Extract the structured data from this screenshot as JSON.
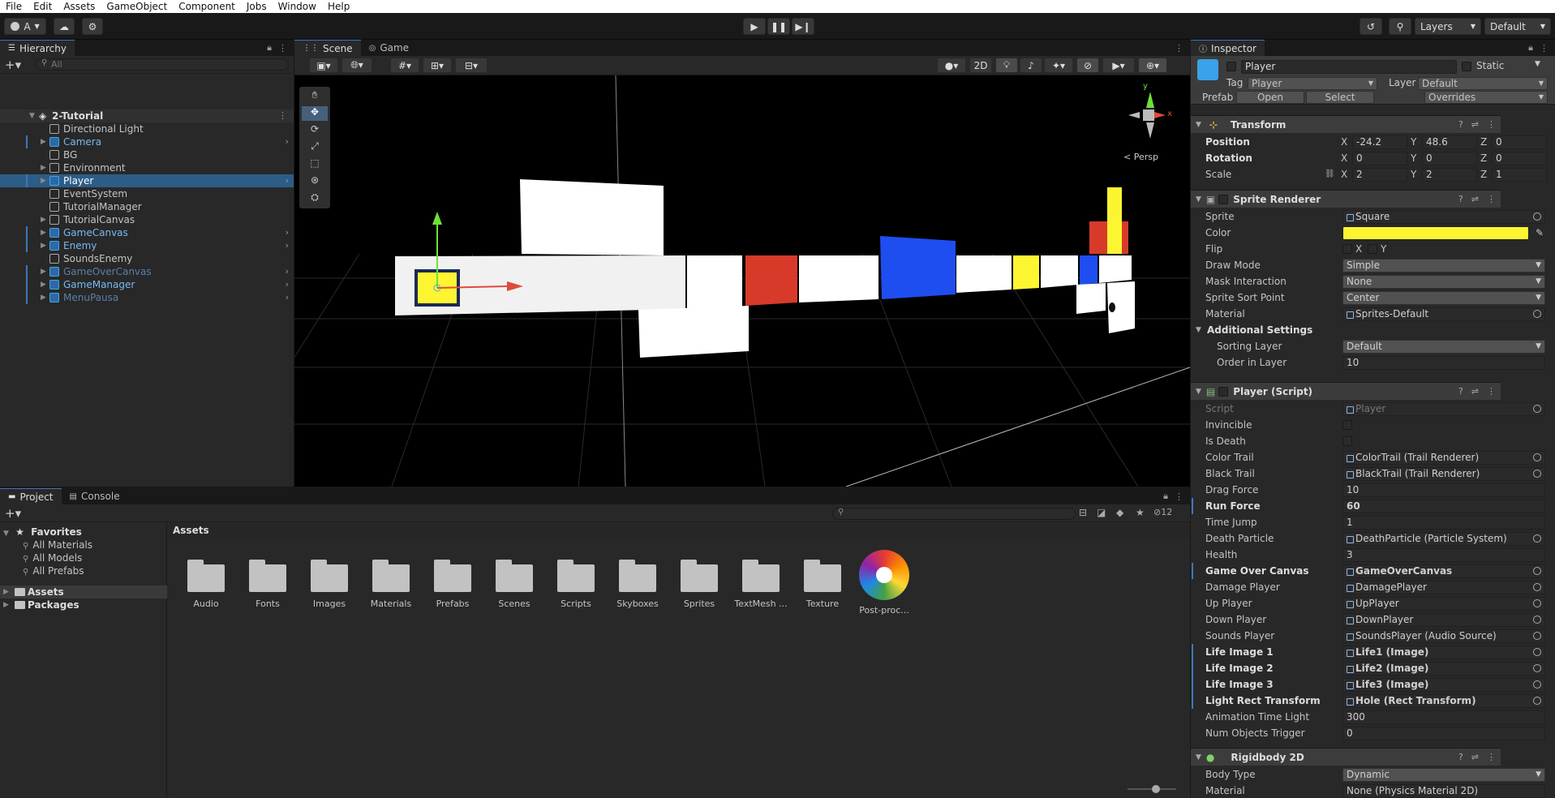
{
  "menu": [
    "File",
    "Edit",
    "Assets",
    "GameObject",
    "Component",
    "Jobs",
    "Window",
    "Help"
  ],
  "toolbar": {
    "account": "A",
    "layers": "Layers",
    "layout": "Default"
  },
  "hierarchy": {
    "tab": "Hierarchy",
    "search_placeholder": "All",
    "scene": "2-Tutorial",
    "items": [
      {
        "label": "Directional Light",
        "indent": 1,
        "arrow": false,
        "blue": false,
        "chev": false
      },
      {
        "label": "Camera",
        "indent": 1,
        "arrow": true,
        "blue": true,
        "chev": true
      },
      {
        "label": "BG",
        "indent": 1,
        "arrow": false,
        "blue": false,
        "chev": false
      },
      {
        "label": "Environment",
        "indent": 1,
        "arrow": true,
        "blue": false,
        "chev": false
      },
      {
        "label": "Player",
        "indent": 1,
        "arrow": true,
        "blue": true,
        "chev": true,
        "selected": true
      },
      {
        "label": "EventSystem",
        "indent": 1,
        "arrow": false,
        "blue": false,
        "chev": false
      },
      {
        "label": "TutorialManager",
        "indent": 1,
        "arrow": false,
        "blue": false,
        "chev": false
      },
      {
        "label": "TutorialCanvas",
        "indent": 1,
        "arrow": true,
        "blue": false,
        "chev": false
      },
      {
        "label": "GameCanvas",
        "indent": 1,
        "arrow": true,
        "blue": true,
        "chev": true
      },
      {
        "label": "Enemy",
        "indent": 1,
        "arrow": true,
        "blue": true,
        "chev": true
      },
      {
        "label": "SoundsEnemy",
        "indent": 1,
        "arrow": false,
        "blue": false,
        "chev": false
      },
      {
        "label": "GameOverCanvas",
        "indent": 1,
        "arrow": true,
        "blue": true,
        "chev": true,
        "dim": true
      },
      {
        "label": "GameManager",
        "indent": 1,
        "arrow": true,
        "blue": true,
        "chev": true
      },
      {
        "label": "MenuPausa",
        "indent": 1,
        "arrow": true,
        "blue": true,
        "chev": true,
        "dim": true
      }
    ]
  },
  "scene": {
    "tabs": [
      "Scene",
      "Game"
    ],
    "btn_2d": "2D",
    "persp": "< Persp",
    "gizmo": {
      "y": "y",
      "x": "x"
    }
  },
  "project": {
    "tabs": [
      "Project",
      "Console"
    ],
    "favorites_label": "Favorites",
    "favorites": [
      "All Materials",
      "All Models",
      "All Prefabs"
    ],
    "roots": [
      "Assets",
      "Packages"
    ],
    "breadcrumb": "Assets",
    "hidden_count": "12",
    "folders": [
      "Audio",
      "Fonts",
      "Images",
      "Materials",
      "Prefabs",
      "Scenes",
      "Scripts",
      "Skyboxes",
      "Sprites",
      "TextMesh ...",
      "Texture"
    ],
    "extra_asset": "Post-proc..."
  },
  "inspector": {
    "tab": "Inspector",
    "object_name": "Player",
    "static_label": "Static",
    "tag_label": "Tag",
    "tag_value": "Player",
    "layer_label": "Layer",
    "layer_value": "Default",
    "prefab_label": "Prefab",
    "prefab_open": "Open",
    "prefab_select": "Select",
    "prefab_overrides": "Overrides",
    "transform": {
      "title": "Transform",
      "position_label": "Position",
      "rotation_label": "Rotation",
      "scale_label": "Scale",
      "position": [
        "-24.2",
        "48.6",
        "0"
      ],
      "rotation": [
        "0",
        "0",
        "0"
      ],
      "scale": [
        "2",
        "2",
        "1"
      ],
      "axes": [
        "X",
        "Y",
        "Z"
      ]
    },
    "sprite_renderer": {
      "title": "Sprite Renderer",
      "rows": [
        {
          "k": "Sprite",
          "v": "Square",
          "type": "obj"
        },
        {
          "k": "Color",
          "v": "",
          "type": "color"
        },
        {
          "k": "Flip",
          "v": "",
          "type": "flip"
        },
        {
          "k": "Draw Mode",
          "v": "Simple",
          "type": "drop"
        },
        {
          "k": "Mask Interaction",
          "v": "None",
          "type": "drop"
        },
        {
          "k": "Sprite Sort Point",
          "v": "Center",
          "type": "drop"
        },
        {
          "k": "Material",
          "v": "Sprites-Default",
          "type": "obj"
        }
      ],
      "flip_x": "X",
      "flip_y": "Y",
      "color_hex": "#fdf531",
      "additional": "Additional Settings",
      "sorting_layer_label": "Sorting Layer",
      "sorting_layer": "Default",
      "order_label": "Order in Layer",
      "order": "10"
    },
    "player_script": {
      "title": "Player (Script)",
      "rows": [
        {
          "k": "Script",
          "v": "Player",
          "type": "obj",
          "dim": true
        },
        {
          "k": "Invincible",
          "v": "",
          "type": "check"
        },
        {
          "k": "Is Death",
          "v": "",
          "type": "check"
        },
        {
          "k": "Color Trail",
          "v": "ColorTrail (Trail Renderer)",
          "type": "obj"
        },
        {
          "k": "Black Trail",
          "v": "BlackTrail (Trail Renderer)",
          "type": "obj"
        },
        {
          "k": "Drag Force",
          "v": "10",
          "type": "text"
        },
        {
          "k": "Run Force",
          "v": "60",
          "type": "text",
          "bold": true
        },
        {
          "k": "Time Jump",
          "v": "1",
          "type": "text"
        },
        {
          "k": "Death Particle",
          "v": "DeathParticle (Particle System)",
          "type": "obj"
        },
        {
          "k": "Health",
          "v": "3",
          "type": "text"
        },
        {
          "k": "Game Over Canvas",
          "v": "GameOverCanvas",
          "type": "obj",
          "bold": true
        },
        {
          "k": "Damage Player",
          "v": "DamagePlayer",
          "type": "obj"
        },
        {
          "k": "Up Player",
          "v": "UpPlayer",
          "type": "obj"
        },
        {
          "k": "Down Player",
          "v": "DownPlayer",
          "type": "obj"
        },
        {
          "k": "Sounds Player",
          "v": "SoundsPlayer (Audio Source)",
          "type": "obj"
        },
        {
          "k": "Life Image 1",
          "v": "Life1 (Image)",
          "type": "obj",
          "bold": true
        },
        {
          "k": "Life Image 2",
          "v": "Life2 (Image)",
          "type": "obj",
          "bold": true
        },
        {
          "k": "Life Image 3",
          "v": "Life3 (Image)",
          "type": "obj",
          "bold": true
        },
        {
          "k": "Light Rect Transform",
          "v": "Hole (Rect Transform)",
          "type": "obj",
          "bold": true
        },
        {
          "k": "Animation Time Light",
          "v": "300",
          "type": "text"
        },
        {
          "k": "Num Objects Trigger",
          "v": "0",
          "type": "text"
        }
      ]
    },
    "rigidbody": {
      "title": "Rigidbody 2D",
      "body_type_label": "Body Type",
      "body_type": "Dynamic",
      "material_label": "Material",
      "material": "None (Physics Material 2D)"
    }
  },
  "colors": {
    "accent": "#3a79bb",
    "selection": "#2c5d87",
    "red": "#d83a2a",
    "blue": "#1e4ef0",
    "yellow": "#fdf531"
  }
}
